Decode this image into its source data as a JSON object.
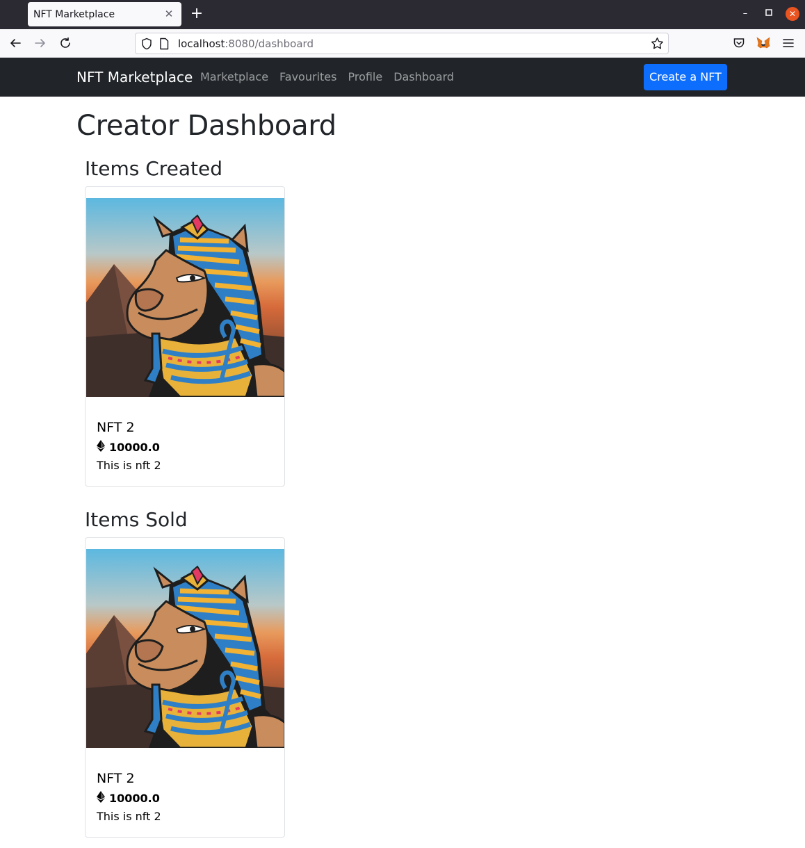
{
  "browser": {
    "tab_title": "NFT Marketplace",
    "url_host": "localhost",
    "url_path": ":8080/dashboard"
  },
  "app": {
    "brand": "NFT Marketplace",
    "nav": [
      "Marketplace",
      "Favourites",
      "Profile",
      "Dashboard"
    ],
    "create_button": "Create a NFT",
    "accent_color": "#0d6efd",
    "navbar_color": "#212529"
  },
  "dashboard": {
    "title": "Creator Dashboard",
    "created_heading": "Items Created",
    "sold_heading": "Items Sold",
    "created_items": [
      {
        "name": "NFT 2",
        "price": "10000.0",
        "description": "This is nft 2",
        "currency_icon": "ethereum-icon"
      }
    ],
    "sold_items": [
      {
        "name": "NFT 2",
        "price": "10000.0",
        "description": "This is nft 2",
        "currency_icon": "ethereum-icon"
      }
    ]
  }
}
